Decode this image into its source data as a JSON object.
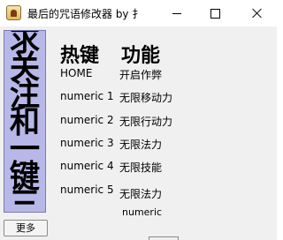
{
  "window": {
    "title": "最后的咒语修改器 by 扌",
    "controls": {
      "minimize": "minimize",
      "maximize": "maximize",
      "close": "close"
    }
  },
  "side_panel": {
    "vertical_text": "求关注和一键三连"
  },
  "more_button": {
    "label": "更多"
  },
  "headers": {
    "hotkey": "热键",
    "function": "功能"
  },
  "rows": [
    {
      "key": "HOME",
      "function": "开启作弊"
    },
    {
      "key": "numeric 1",
      "function": "无限移动力"
    },
    {
      "key": "numeric 2",
      "function": "无限行动力"
    },
    {
      "key": "numeric 3",
      "function": "无限法力"
    },
    {
      "key": "numeric 4",
      "function": "无限技能"
    },
    {
      "key": "numeric 5",
      "function": "无限法力"
    },
    {
      "key": "",
      "function": "numeric"
    }
  ],
  "colors": {
    "side_panel_bg": "#b8b8e8",
    "window_bg": "#f0f0f0"
  }
}
